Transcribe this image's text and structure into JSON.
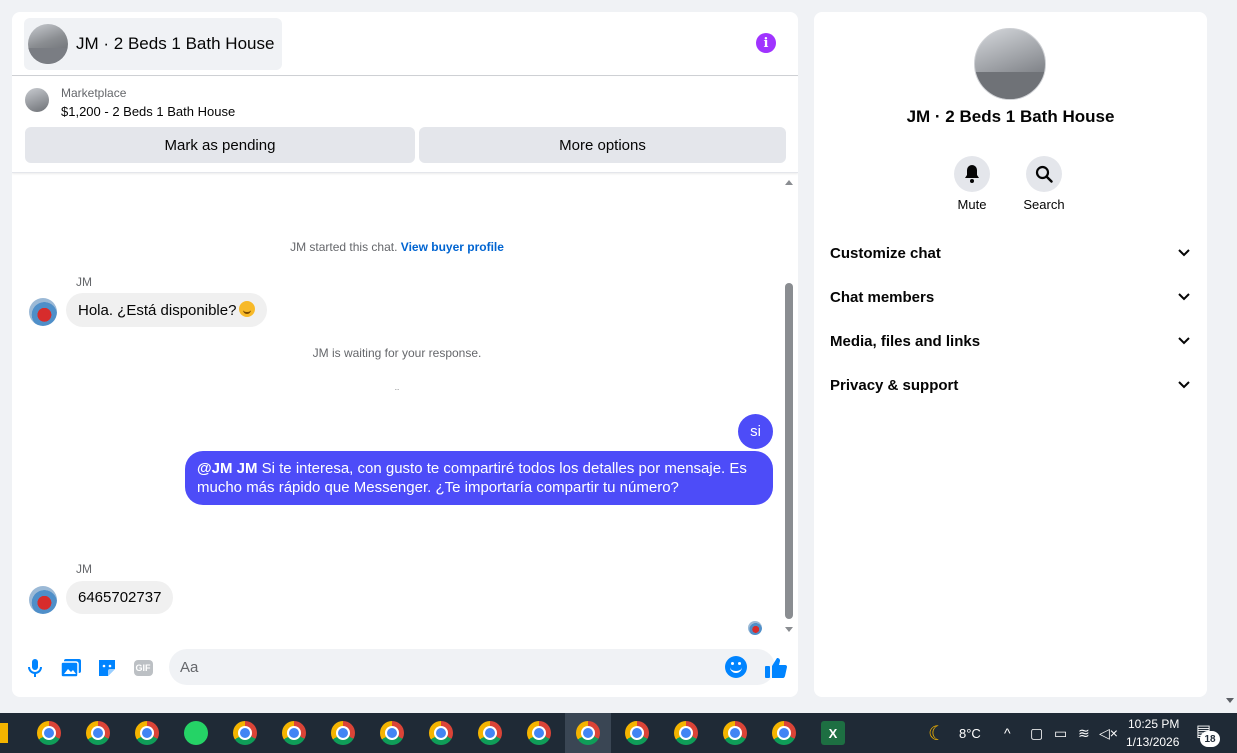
{
  "chat": {
    "title": "JM · 2 Beds 1 Bath House",
    "info_icon": "info-icon",
    "listing": {
      "label": "Marketplace",
      "price_title": "$1,200 - 2 Beds 1 Bath House"
    },
    "buttons": {
      "mark_pending": "Mark as pending",
      "more_options": "More options"
    },
    "system": {
      "started_prefix": "JM started this chat. ",
      "view_profile": "View buyer profile",
      "waiting": "JM is waiting for your response.",
      "dots": ".."
    },
    "messages": [
      {
        "sender": "JM",
        "text": "Hola. ¿Está disponible?",
        "emoji": "smile-emoji"
      },
      {
        "sender": "me",
        "text": "si"
      },
      {
        "sender": "me",
        "mention": "@JM JM",
        "text": " Si te interesa, con gusto te compartiré todos los detalles por mensaje. Es mucho más rápido que Messenger. ¿Te importaría compartir tu número?"
      },
      {
        "sender": "JM",
        "text": "6465702737"
      }
    ],
    "composer": {
      "placeholder": "Aa",
      "icons": [
        "microphone-icon",
        "image-icon",
        "sticker-icon",
        "gif-icon",
        "emoji-icon",
        "like-icon"
      ],
      "gif_label": "GIF"
    }
  },
  "info_panel": {
    "title": "JM · 2 Beds 1 Bath House",
    "actions": [
      {
        "label": "Mute",
        "icon": "bell-icon"
      },
      {
        "label": "Search",
        "icon": "search-icon"
      }
    ],
    "sections": [
      "Customize chat",
      "Chat members",
      "Media, files and links",
      "Privacy & support"
    ]
  },
  "taskbar": {
    "weather": "8°C",
    "time": "10:25 PM",
    "date": "1/13/2026",
    "notifications": "18",
    "excel_label": "X"
  },
  "colors": {
    "outgoing_bubble": "#4d4cf8",
    "link": "#0064d1",
    "accent_icon": "#0084ff",
    "info_icon": "#a033ff"
  }
}
